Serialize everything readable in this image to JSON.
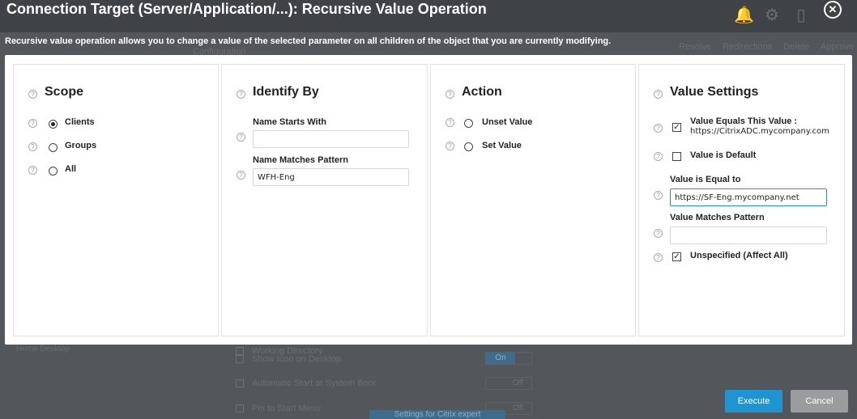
{
  "dialog": {
    "title": "Connection Target (Server/Application/...): Recursive Value Operation",
    "description": "Recursive value operation allows you to change a value of the selected parameter on all children of the object that you are currently modifying.",
    "close_glyph": "✕"
  },
  "background": {
    "configuration": "Configuration",
    "actions": [
      "Resolve",
      "Redirections",
      "Delete",
      "Approve"
    ],
    "nav_item": "Home Desktop",
    "rows": [
      {
        "label": "Working Directory"
      },
      {
        "label": "Show Icon on Desktop",
        "toggle": "On"
      },
      {
        "label": "Automatic Start at System Boot",
        "toggle": "Off"
      },
      {
        "label": "Pin to Start Menu",
        "toggle": "Off"
      }
    ],
    "settings_button": "Settings for Citrix expert"
  },
  "help_glyph": "?",
  "scope": {
    "title": "Scope",
    "options": [
      {
        "label": "Clients",
        "checked": true
      },
      {
        "label": "Groups",
        "checked": false
      },
      {
        "label": "All",
        "checked": false
      }
    ]
  },
  "identify": {
    "title": "Identify By",
    "name_starts_label": "Name Starts With",
    "name_starts_value": "",
    "name_matches_label": "Name Matches Pattern",
    "name_matches_value": "WFH-Eng"
  },
  "action": {
    "title": "Action",
    "options": [
      {
        "label": "Unset Value",
        "checked": false
      },
      {
        "label": "Set Value",
        "checked": false
      }
    ]
  },
  "value_settings": {
    "title": "Value Settings",
    "equals_this_label": "Value Equals This Value :",
    "equals_this_value": "https://CitrixADC.mycompany.com",
    "equals_this_checked": true,
    "is_default_label": "Value is Default",
    "is_default_checked": false,
    "is_equal_to_label": "Value is Equal to",
    "is_equal_to_value": "https://SF-Eng.mycompany.net",
    "matches_pattern_label": "Value Matches Pattern",
    "matches_pattern_value": "",
    "unspecified_label": "Unspecified (Affect All)",
    "unspecified_checked": true,
    "check_glyph": "✓"
  },
  "buttons": {
    "execute": "Execute",
    "cancel": "Cancel"
  }
}
